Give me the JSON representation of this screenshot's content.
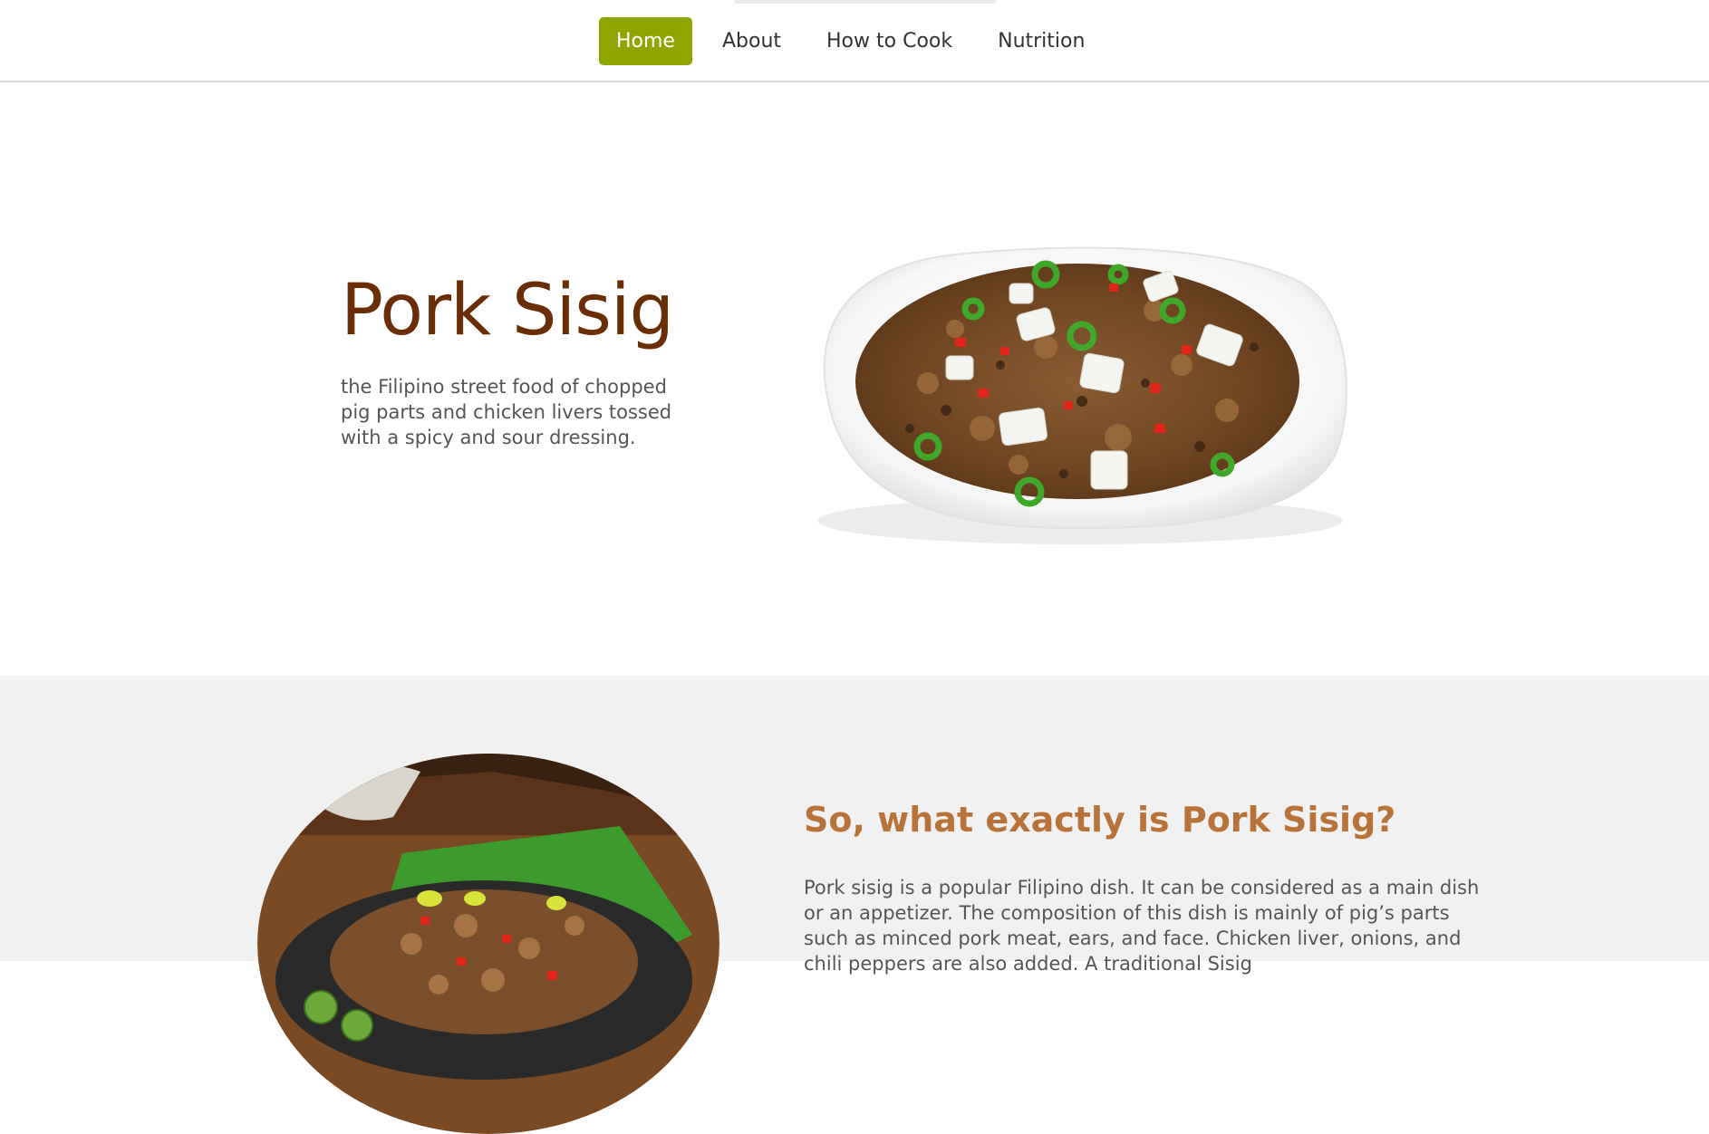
{
  "nav": {
    "items": [
      {
        "label": "Home",
        "active": true
      },
      {
        "label": "About",
        "active": false
      },
      {
        "label": "How to Cook",
        "active": false
      },
      {
        "label": "Nutrition",
        "active": false
      }
    ]
  },
  "hero": {
    "title": "Pork Sisig",
    "description": "the Filipino street food of chopped pig parts and chicken livers tossed with a spicy and sour dressing."
  },
  "about": {
    "title": "So, what exactly is Pork Sisig?",
    "text": "Pork sisig is a popular Filipino dish. It can be considered as a main dish or an appetizer. The composition of this dish is mainly of pig’s parts such as minced pork meat, ears, and face. Chicken liver, onions, and chili peppers are also added. A traditional Sisig"
  },
  "colors": {
    "accent": "#8fa500",
    "title": "#6a2e07",
    "subtitle": "#b8733a",
    "section_bg": "#f1f1f1"
  }
}
